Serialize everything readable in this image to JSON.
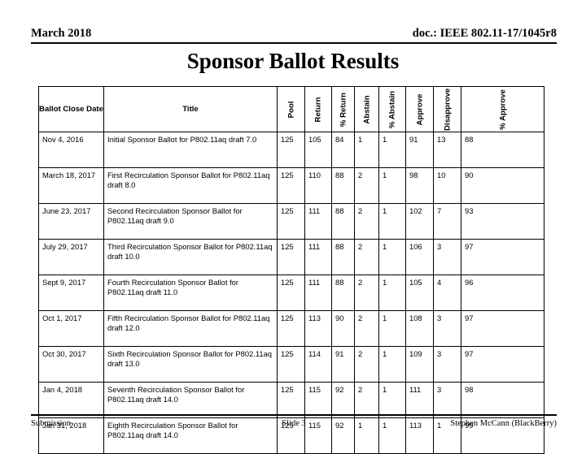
{
  "header": {
    "left": "March 2018",
    "right": "doc.: IEEE 802.11-17/1045r8"
  },
  "title": "Sponsor Ballot Results",
  "table": {
    "columns": [
      {
        "label": "Ballot Close Date",
        "orientation": "horizontal",
        "key": "date"
      },
      {
        "label": "Title",
        "orientation": "horizontal",
        "key": "title"
      },
      {
        "label": "Pool",
        "orientation": "vertical",
        "key": "pool"
      },
      {
        "label": "Return",
        "orientation": "vertical",
        "key": "return"
      },
      {
        "label": "% Return",
        "orientation": "vertical",
        "key": "pct_return"
      },
      {
        "label": "Abstain",
        "orientation": "vertical",
        "key": "abstain"
      },
      {
        "label": "% Abstain",
        "orientation": "vertical",
        "key": "pct_abstain"
      },
      {
        "label": "Approve",
        "orientation": "vertical",
        "key": "approve"
      },
      {
        "label": "Disapprove",
        "orientation": "vertical",
        "key": "disapprove"
      },
      {
        "label": "% Approve",
        "orientation": "vertical",
        "key": "pct_approve"
      }
    ],
    "rows": [
      {
        "date": "Nov 4, 2016",
        "title": "Initial Sponsor Ballot for P802.11aq draft 7.0",
        "pool": "125",
        "return": "105",
        "pct_return": "84",
        "abstain": "1",
        "pct_abstain": "1",
        "approve": "91",
        "disapprove": "13",
        "pct_approve": "88",
        "shaded": true
      },
      {
        "date": "March 18, 2017",
        "title": "First Recirculation Sponsor  Ballot for P802.11aq draft 8.0",
        "pool": "125",
        "return": "110",
        "pct_return": "88",
        "abstain": "2",
        "pct_abstain": "1",
        "approve": "98",
        "disapprove": "10",
        "pct_approve": "90",
        "shaded": false
      },
      {
        "date": "June 23, 2017",
        "title": "Second Recirculation Sponsor Ballot for P802.11aq draft 9.0",
        "pool": "125",
        "return": "111",
        "pct_return": "88",
        "abstain": "2",
        "pct_abstain": "1",
        "approve": "102",
        "disapprove": "7",
        "pct_approve": "93",
        "shaded": true
      },
      {
        "date": "July 29, 2017",
        "title": "Third Recirculation Sponsor Ballot for P802.11aq draft 10.0",
        "pool": "125",
        "return": "111",
        "pct_return": "88",
        "abstain": "2",
        "pct_abstain": "1",
        "approve": "106",
        "disapprove": "3",
        "pct_approve": "97",
        "shaded": false
      },
      {
        "date": "Sept 9, 2017",
        "title": "Fourth Recirculation Sponsor Ballot for P802.11aq draft 11.0",
        "pool": "125",
        "return": "111",
        "pct_return": "88",
        "abstain": "2",
        "pct_abstain": "1",
        "approve": "105",
        "disapprove": "4",
        "pct_approve": "96",
        "shaded": true
      },
      {
        "date": "Oct 1, 2017",
        "title": "Fifth Recirculation Sponsor Ballot for P802.11aq draft 12.0",
        "pool": "125",
        "return": "113",
        "pct_return": "90",
        "abstain": "2",
        "pct_abstain": "1",
        "approve": "108",
        "disapprove": "3",
        "pct_approve": "97",
        "shaded": false
      },
      {
        "date": "Oct 30, 2017",
        "title": "Sixth Recirculation Sponsor Ballot for P802.11aq draft 13.0",
        "pool": "125",
        "return": "114",
        "pct_return": "91",
        "abstain": "2",
        "pct_abstain": "1",
        "approve": "109",
        "disapprove": "3",
        "pct_approve": "97",
        "shaded": true
      },
      {
        "date": "Jan 4, 2018",
        "title": "Seventh Recirculation Sponsor Ballot for P802.11aq draft 14.0",
        "pool": "125",
        "return": "115",
        "pct_return": "92",
        "abstain": "2",
        "pct_abstain": "1",
        "approve": "111",
        "disapprove": "3",
        "pct_approve": "98",
        "shaded": false
      },
      {
        "date": "Jan 31, 2018",
        "title": "Eighth Recirculation Sponsor Ballot for P802.11aq draft 14.0",
        "pool": "125",
        "return": "115",
        "pct_return": "92",
        "abstain": "1",
        "pct_abstain": "1",
        "approve": "113",
        "disapprove": "1",
        "pct_approve": "99",
        "shaded": true
      }
    ]
  },
  "footer": {
    "left": "Submission",
    "center": "Slide 3",
    "right": "Stephen McCann (BlackBerry)"
  },
  "colors": {
    "shaded_row": "#c0c0c0",
    "border": "#000000",
    "background": "#ffffff"
  }
}
